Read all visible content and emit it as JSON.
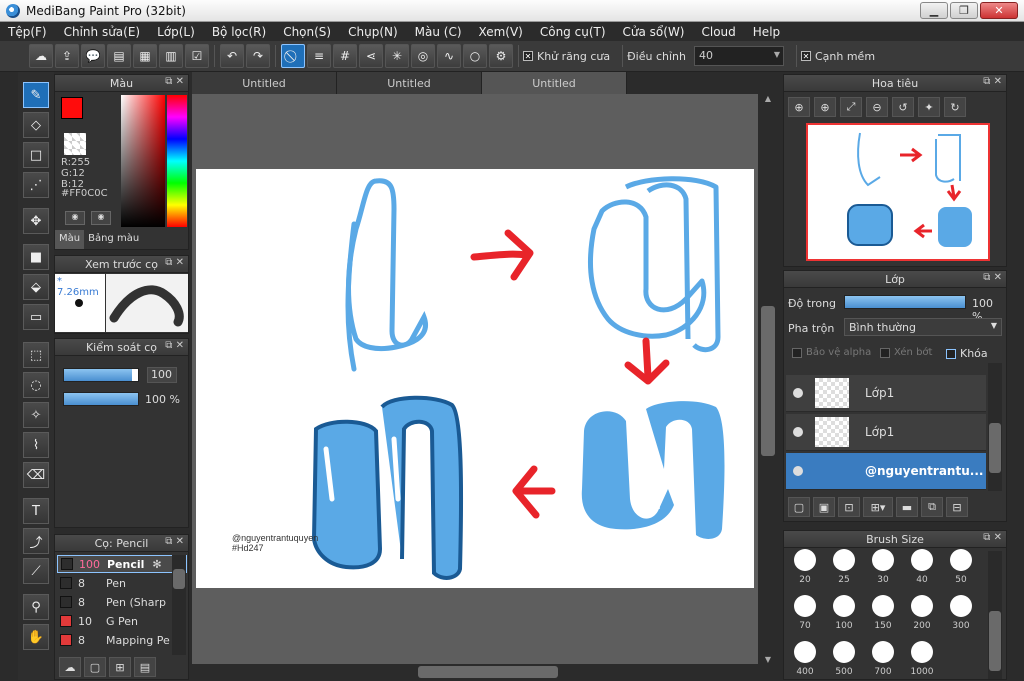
{
  "window": {
    "title": "MediBang Paint Pro (32bit)",
    "min": "▁",
    "max": "❐",
    "close": "✕"
  },
  "menu": [
    "Tệp(F)",
    "Chỉnh sửa(E)",
    "Lớp(L)",
    "Bộ lọc(R)",
    "Chọn(S)",
    "Chụp(N)",
    "Màu (C)",
    "Xem(V)",
    "Công cụ(T)",
    "Cửa sổ(W)",
    "Cloud",
    "Help"
  ],
  "toolbar": {
    "antialias_label": "Khử răng cưa",
    "adjust_label": "Điều chỉnh",
    "adjust_value": "40",
    "soft_label": "Cạnh mềm"
  },
  "tabs": [
    "Untitled",
    "Untitled",
    "Untitled"
  ],
  "color_panel": {
    "title": "Màu",
    "r": "R:255",
    "g": "G:12",
    "b": "B:12",
    "hex": "#FF0C0C",
    "tab1": "Màu",
    "tab2": "Bảng màu",
    "fg": "#ff0c0c",
    "bg": "#f7a0e8"
  },
  "preview_panel": {
    "title": "Xem trước cọ",
    "size": "* 7.26mm"
  },
  "control_panel": {
    "title": "Kiểm soát cọ",
    "v1": "100",
    "v2": "100 %"
  },
  "brush_panel": {
    "title": "Cọ: Pencil",
    "items": [
      {
        "size": "100",
        "name": "Pencil",
        "color": "#2d2d2d"
      },
      {
        "size": "8",
        "name": "Pen",
        "color": "#2d2d2d"
      },
      {
        "size": "8",
        "name": "Pen (Sharp",
        "color": "#2d2d2d"
      },
      {
        "size": "10",
        "name": "G Pen",
        "color": "#e23a3a"
      },
      {
        "size": "8",
        "name": "Mapping Pe",
        "color": "#e23a3a"
      }
    ]
  },
  "navigator": {
    "title": "Hoa tiêu"
  },
  "layer_panel": {
    "title": "Lớp",
    "opacity_label": "Độ trong",
    "opacity_value": "100 %",
    "blend_label": "Pha trộn",
    "blend_value": "Bình thường",
    "protect_alpha": "Bảo vệ alpha",
    "clip": "Xén bớt",
    "lock": "Khóa",
    "layers": [
      {
        "name": "Lớp1"
      },
      {
        "name": "Lớp1"
      },
      {
        "name": "@nguyentrantu..."
      }
    ]
  },
  "brush_size_panel": {
    "title": "Brush Size",
    "sizes": [
      "20",
      "25",
      "30",
      "40",
      "50",
      "70",
      "100",
      "150",
      "200",
      "300",
      "400",
      "500",
      "700",
      "1000"
    ]
  },
  "canvas_text": {
    "credit1": "@nguyentrantuquyen",
    "credit2": "#Hd247"
  },
  "colors": {
    "accent": "#1f6fb8",
    "hook": "#5aa9e6",
    "arrow": "#e8242a"
  }
}
